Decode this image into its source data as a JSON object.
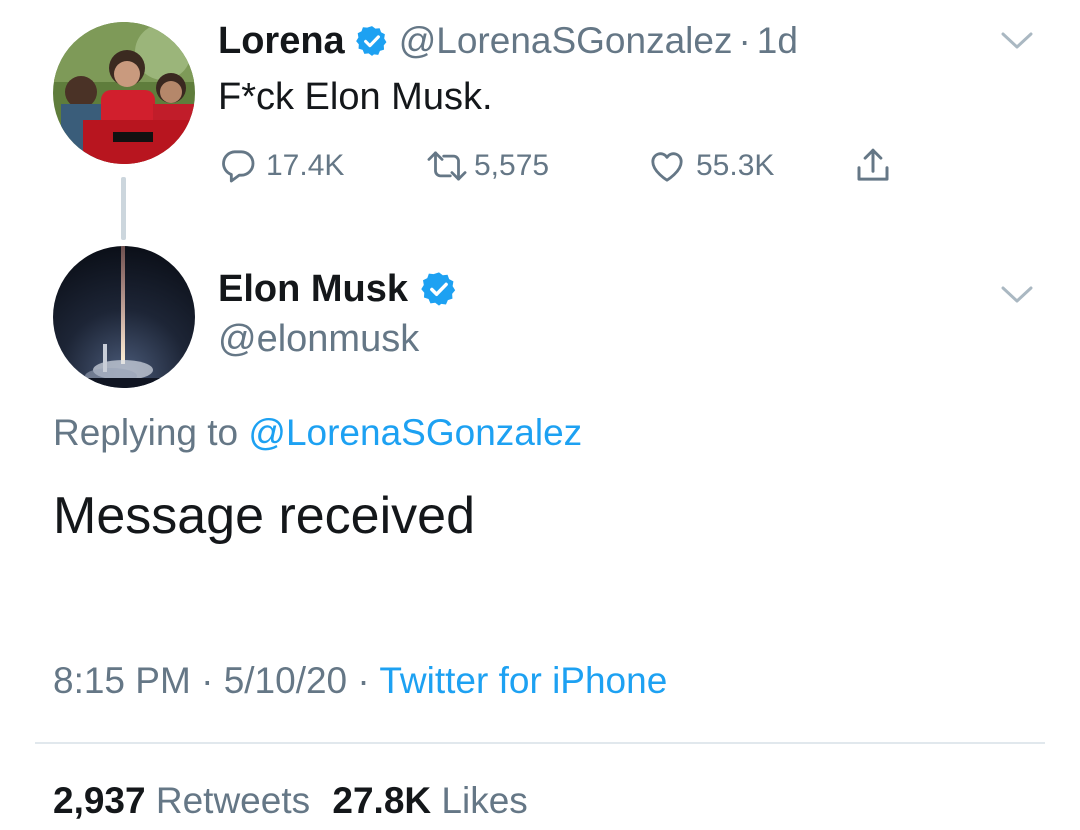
{
  "parent_tweet": {
    "display_name": "Lorena",
    "handle": "@LorenaSGonzalez",
    "separator": "·",
    "age": "1d",
    "text": "F*ck Elon Musk.",
    "replies": "17.4K",
    "retweets": "5,575",
    "likes": "55.3K"
  },
  "main_tweet": {
    "display_name": "Elon Musk",
    "handle": "@elonmusk",
    "replying_prefix": "Replying to",
    "replying_handle": "@LorenaSGonzalez",
    "text": "Message received",
    "time": "8:15 PM",
    "sep1": "·",
    "date": "5/10/20",
    "sep2": "·",
    "source": "Twitter for iPhone",
    "retweet_count": "2,937",
    "retweet_label": "Retweets",
    "like_count": "27.8K",
    "like_label": "Likes"
  },
  "colors": {
    "accent": "#1da1f2",
    "secondary_text": "#657786",
    "primary_text": "#14171a",
    "divider": "#e1e8ed"
  }
}
